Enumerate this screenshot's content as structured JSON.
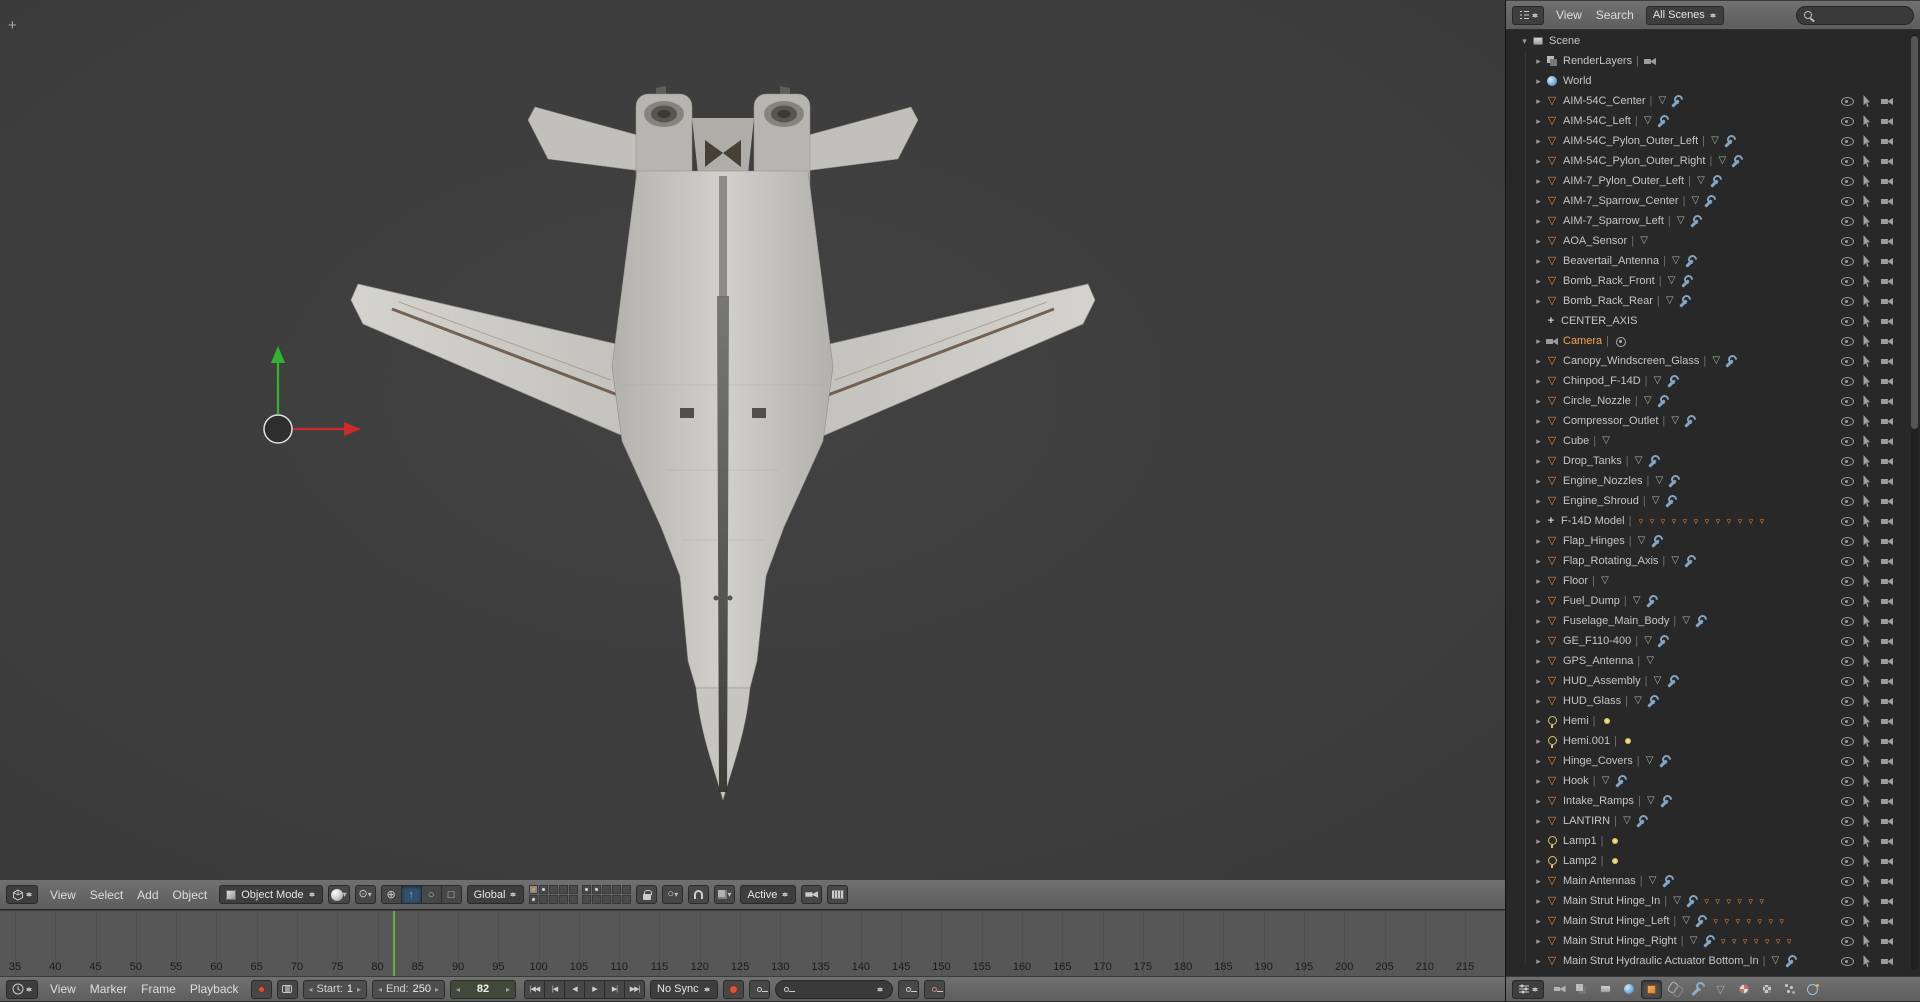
{
  "colors": {
    "viewport_bg": "#3e3e3e",
    "header_bg": "#686868",
    "outliner_bg": "#282828",
    "timeline_bg": "#575757",
    "accent_orange": "#e0873c",
    "selected_text_orange": "#f5a455",
    "current_frame_green": "#61b32f",
    "axis_red": "#cd2a2a",
    "axis_green": "#35b135"
  },
  "icons": {
    "expander_open": "▾",
    "expander_closed": "▸",
    "caret_down": "▾",
    "mesh": "▽",
    "mesh_data": "▽",
    "child_object": "▿",
    "empty": "+",
    "separator": "|",
    "pivot": "⊙",
    "proportional": "○",
    "manipulator": [
      "⊕",
      "↑",
      "○",
      "□"
    ],
    "stepper_left": "◂",
    "stepper_right": "▸",
    "plus_widget": "+",
    "transport": [
      "|◀◀",
      "|◀",
      "◀",
      "▶",
      "▶|",
      "▶▶|"
    ]
  },
  "viewport": {
    "header": {
      "menus": [
        "View",
        "Select",
        "Add",
        "Object"
      ],
      "mode_label": "Object Mode",
      "orientation_label": "Global",
      "snap_target_label": "Active"
    },
    "layers": {
      "count": 20,
      "active_index": 0,
      "dot_indices": [
        0,
        1,
        5,
        10,
        11
      ]
    }
  },
  "timeline": {
    "header": {
      "menus": [
        "View",
        "Marker",
        "Frame",
        "Playback"
      ],
      "start_label": "Start:",
      "start_value": "1",
      "end_label": "End:",
      "end_value": "250",
      "current_frame": "82",
      "sync_label": "No Sync"
    },
    "ruler": {
      "labels": [
        35,
        40,
        45,
        50,
        55,
        60,
        65,
        70,
        75,
        80,
        85,
        90,
        95,
        100,
        105,
        110,
        115,
        120,
        125,
        130,
        135,
        140,
        145,
        150,
        155,
        160,
        165,
        170,
        175,
        180,
        185,
        190,
        195,
        200,
        205,
        210,
        215
      ],
      "step": 5,
      "current": 82
    }
  },
  "outliner": {
    "header": {
      "menus": [
        "View",
        "Search"
      ],
      "scenes_filter": "All Scenes"
    },
    "rows": [
      {
        "name": "Scene",
        "icon": "scene",
        "level": 0,
        "expander": "open",
        "extras": [],
        "toggles": false
      },
      {
        "name": "RenderLayers",
        "icon": "renderlayers",
        "level": 1,
        "expander": "closed",
        "extras": [
          "render"
        ],
        "toggles": false
      },
      {
        "name": "World",
        "icon": "world",
        "level": 1,
        "expander": "closed",
        "extras": [],
        "toggles": false
      },
      {
        "name": "AIM-54C_Center",
        "icon": "mesh",
        "level": 1,
        "expander": "closed",
        "extras": [
          "mesh-data",
          "wrench"
        ],
        "toggles": true
      },
      {
        "name": "AIM-54C_Left",
        "icon": "mesh",
        "level": 1,
        "expander": "closed",
        "extras": [
          "mesh-data",
          "wrench"
        ],
        "toggles": true
      },
      {
        "name": "AIM-54C_Pylon_Outer_Left",
        "icon": "mesh",
        "level": 1,
        "expander": "closed",
        "extras": [
          "mesh-data",
          "wrench"
        ],
        "toggles": true
      },
      {
        "name": "AIM-54C_Pylon_Outer_Right",
        "icon": "mesh",
        "level": 1,
        "expander": "closed",
        "extras": [
          "mesh-data",
          "wrench"
        ],
        "toggles": true
      },
      {
        "name": "AIM-7_Pylon_Outer_Left",
        "icon": "mesh",
        "level": 1,
        "expander": "closed",
        "extras": [
          "mesh-data",
          "wrench"
        ],
        "toggles": true
      },
      {
        "name": "AIM-7_Sparrow_Center",
        "icon": "mesh",
        "level": 1,
        "expander": "closed",
        "extras": [
          "mesh-data",
          "wrench"
        ],
        "toggles": true
      },
      {
        "name": "AIM-7_Sparrow_Left",
        "icon": "mesh",
        "level": 1,
        "expander": "closed",
        "extras": [
          "mesh-data",
          "wrench"
        ],
        "toggles": true
      },
      {
        "name": "AOA_Sensor",
        "icon": "mesh",
        "level": 1,
        "expander": "closed",
        "extras": [
          "mesh-data"
        ],
        "toggles": true
      },
      {
        "name": "Beavertail_Antenna",
        "icon": "mesh",
        "level": 1,
        "expander": "closed",
        "extras": [
          "mesh-data",
          "wrench"
        ],
        "toggles": true
      },
      {
        "name": "Bomb_Rack_Front",
        "icon": "mesh",
        "level": 1,
        "expander": "closed",
        "extras": [
          "mesh-data",
          "wrench"
        ],
        "toggles": true
      },
      {
        "name": "Bomb_Rack_Rear",
        "icon": "mesh",
        "level": 1,
        "expander": "closed",
        "extras": [
          "mesh-data",
          "wrench"
        ],
        "toggles": true
      },
      {
        "name": "CENTER_AXIS",
        "icon": "empty",
        "level": 1,
        "expander": "none",
        "extras": [],
        "toggles": true
      },
      {
        "name": "Camera",
        "icon": "camera",
        "level": 1,
        "expander": "closed",
        "extras": [
          "camera-badge"
        ],
        "toggles": true,
        "active": true
      },
      {
        "name": "Canopy_Windscreen_Glass",
        "icon": "mesh",
        "level": 1,
        "expander": "closed",
        "extras": [
          "mesh-data",
          "wrench"
        ],
        "toggles": true
      },
      {
        "name": "Chinpod_F-14D",
        "icon": "mesh",
        "level": 1,
        "expander": "closed",
        "extras": [
          "mesh-data",
          "wrench"
        ],
        "toggles": true
      },
      {
        "name": "Circle_Nozzle",
        "icon": "mesh",
        "level": 1,
        "expander": "closed",
        "extras": [
          "mesh-data",
          "wrench"
        ],
        "toggles": true
      },
      {
        "name": "Compressor_Outlet",
        "icon": "mesh",
        "level": 1,
        "expander": "closed",
        "extras": [
          "mesh-data",
          "wrench"
        ],
        "toggles": true
      },
      {
        "name": "Cube",
        "icon": "mesh",
        "level": 1,
        "expander": "closed",
        "extras": [
          "mesh-data"
        ],
        "toggles": true
      },
      {
        "name": "Drop_Tanks",
        "icon": "mesh",
        "level": 1,
        "expander": "closed",
        "extras": [
          "mesh-data",
          "wrench"
        ],
        "toggles": true
      },
      {
        "name": "Engine_Nozzles",
        "icon": "mesh",
        "level": 1,
        "expander": "closed",
        "extras": [
          "mesh-data",
          "wrench"
        ],
        "toggles": true
      },
      {
        "name": "Engine_Shroud",
        "icon": "mesh",
        "level": 1,
        "expander": "closed",
        "extras": [
          "mesh-data",
          "wrench"
        ],
        "toggles": true
      },
      {
        "name": "F-14D Model",
        "icon": "empty",
        "level": 1,
        "expander": "closed",
        "extras": [
          "child",
          "child",
          "child",
          "child",
          "child",
          "child",
          "child",
          "child",
          "child",
          "child",
          "child",
          "child"
        ],
        "toggles": true
      },
      {
        "name": "Flap_Hinges",
        "icon": "mesh",
        "level": 1,
        "expander": "closed",
        "extras": [
          "mesh-data",
          "wrench"
        ],
        "toggles": true
      },
      {
        "name": "Flap_Rotating_Axis",
        "icon": "mesh",
        "level": 1,
        "expander": "closed",
        "extras": [
          "mesh-data",
          "wrench"
        ],
        "toggles": true
      },
      {
        "name": "Floor",
        "icon": "mesh",
        "level": 1,
        "expander": "closed",
        "extras": [
          "mesh-data"
        ],
        "toggles": true
      },
      {
        "name": "Fuel_Dump",
        "icon": "mesh",
        "level": 1,
        "expander": "closed",
        "extras": [
          "mesh-data",
          "wrench"
        ],
        "toggles": true
      },
      {
        "name": "Fuselage_Main_Body",
        "icon": "mesh",
        "level": 1,
        "expander": "closed",
        "extras": [
          "mesh-data",
          "wrench"
        ],
        "toggles": true
      },
      {
        "name": "GE_F110-400",
        "icon": "mesh",
        "level": 1,
        "expander": "closed",
        "extras": [
          "mesh-data",
          "wrench"
        ],
        "toggles": true
      },
      {
        "name": "GPS_Antenna",
        "icon": "mesh",
        "level": 1,
        "expander": "closed",
        "extras": [
          "mesh-data"
        ],
        "toggles": true
      },
      {
        "name": "HUD_Assembly",
        "icon": "mesh",
        "level": 1,
        "expander": "closed",
        "extras": [
          "mesh-data",
          "wrench"
        ],
        "toggles": true
      },
      {
        "name": "HUD_Glass",
        "icon": "mesh",
        "level": 1,
        "expander": "closed",
        "extras": [
          "mesh-data",
          "wrench"
        ],
        "toggles": true
      },
      {
        "name": "Hemi",
        "icon": "lamp",
        "level": 1,
        "expander": "closed",
        "extras": [
          "lamp-data"
        ],
        "toggles": true
      },
      {
        "name": "Hemi.001",
        "icon": "lamp",
        "level": 1,
        "expander": "closed",
        "extras": [
          "lamp-data"
        ],
        "toggles": true
      },
      {
        "name": "Hinge_Covers",
        "icon": "mesh",
        "level": 1,
        "expander": "closed",
        "extras": [
          "mesh-data",
          "wrench"
        ],
        "toggles": true
      },
      {
        "name": "Hook",
        "icon": "mesh",
        "level": 1,
        "expander": "closed",
        "extras": [
          "mesh-data",
          "wrench"
        ],
        "toggles": true
      },
      {
        "name": "Intake_Ramps",
        "icon": "mesh",
        "level": 1,
        "expander": "closed",
        "extras": [
          "mesh-data",
          "wrench"
        ],
        "toggles": true
      },
      {
        "name": "LANTIRN",
        "icon": "mesh",
        "level": 1,
        "expander": "closed",
        "extras": [
          "mesh-data",
          "wrench"
        ],
        "toggles": true
      },
      {
        "name": "Lamp1",
        "icon": "lamp",
        "level": 1,
        "expander": "closed",
        "extras": [
          "lamp-data"
        ],
        "toggles": true
      },
      {
        "name": "Lamp2",
        "icon": "lamp",
        "level": 1,
        "expander": "closed",
        "extras": [
          "lamp-data"
        ],
        "toggles": true
      },
      {
        "name": "Main Antennas",
        "icon": "mesh",
        "level": 1,
        "expander": "closed",
        "extras": [
          "mesh-data",
          "wrench"
        ],
        "toggles": true
      },
      {
        "name": "Main Strut Hinge_In",
        "icon": "mesh",
        "level": 1,
        "expander": "closed",
        "extras": [
          "mesh-data",
          "wrench",
          "child",
          "child",
          "child",
          "child",
          "child",
          "child"
        ],
        "toggles": true
      },
      {
        "name": "Main Strut Hinge_Left",
        "icon": "mesh",
        "level": 1,
        "expander": "closed",
        "extras": [
          "mesh-data",
          "wrench",
          "child",
          "child",
          "child",
          "child",
          "child",
          "child",
          "child"
        ],
        "toggles": true
      },
      {
        "name": "Main Strut Hinge_Right",
        "icon": "mesh",
        "level": 1,
        "expander": "closed",
        "extras": [
          "mesh-data",
          "wrench",
          "child",
          "child",
          "child",
          "child",
          "child",
          "child",
          "child"
        ],
        "toggles": true
      },
      {
        "name": "Main Strut Hydraulic Actuator Bottom_In",
        "icon": "mesh",
        "level": 1,
        "expander": "closed",
        "extras": [
          "mesh-data",
          "wrench"
        ],
        "toggles": true
      }
    ]
  },
  "properties_header": {
    "icons": [
      "render",
      "render-layers",
      "scene",
      "world",
      "object",
      "constraints",
      "modifiers",
      "object-data",
      "material",
      "texture",
      "particles",
      "physics"
    ],
    "active": "object"
  }
}
